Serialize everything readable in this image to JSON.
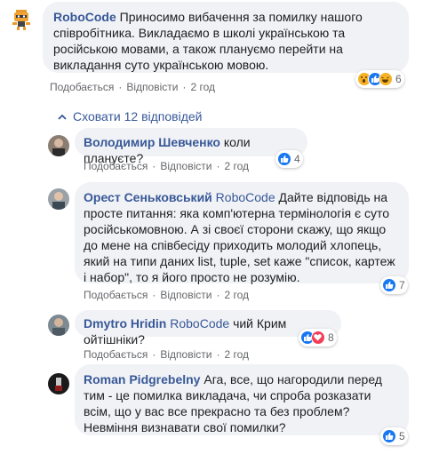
{
  "comments": [
    {
      "author": "RoboCode",
      "text": "Приносимо вибачення за помилку нашого співробітника. Викладаємо в школі українською та російською мовами, а також плануємо перейти на викладання суто українською мовою.",
      "like_label": "Подобається",
      "reply_label": "Відповісти",
      "time": "2 год",
      "reaction_count": "6",
      "reaction_icons": [
        "wow-icon",
        "like-icon",
        "haha-icon"
      ]
    }
  ],
  "hide_replies": "Сховати 12 відповідей",
  "replies": [
    {
      "author": "Володимир Шевченко",
      "mention": "",
      "text": "коли плануєте?",
      "like_label": "Подобається",
      "reply_label": "Відповісти",
      "time": "2 год",
      "reaction_count": "4"
    },
    {
      "author": "Орест Сеньковський",
      "mention": "RoboCode",
      "text": "Дайте відповідь на просте питання: яка комп'ютерна термінологія є суто російськомовною. А зі своєї сторони скажу, що якщо до мене на співбесіду приходить молодий хлопець, який на типи даних list, tuple, set каже \"список, картеж і набор\", то я його просто не розумію.",
      "like_label": "Подобається",
      "reply_label": "Відповісти",
      "time": "2 год",
      "reaction_count": "7"
    },
    {
      "author": "Dmytro Hridin",
      "mention": "RoboCode",
      "text": "чий Крим ойтішніки?",
      "like_label": "Подобається",
      "reply_label": "Відповісти",
      "time": "2 год",
      "reaction_count": "8"
    },
    {
      "author": "Roman Pidgrebelny",
      "mention": "",
      "text": "Ага, все, що нагородили перед тим - це помилка викладача, чи спроба розказати всім, що у вас все прекрасно та без проблем? Невміння визнавати свої помилки?",
      "like_label": "Подобається",
      "reply_label": "Відповісти",
      "time": "2 год",
      "reaction_count": "5"
    }
  ],
  "colors": {
    "link": "#385898",
    "bubble": "#f0f2f5",
    "meta": "#65676b",
    "like": "#1877f2",
    "love": "#f33e58",
    "wow": "#f7b125"
  }
}
